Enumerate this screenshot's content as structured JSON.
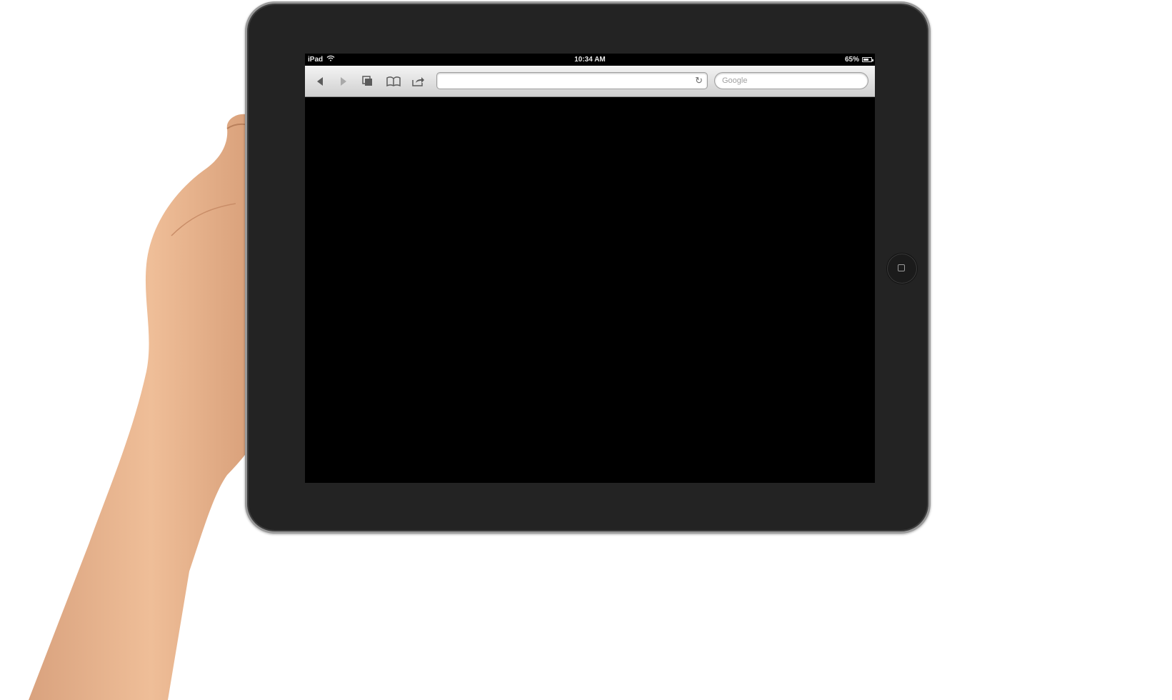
{
  "status_bar": {
    "device": "iPad",
    "time": "10:34 AM",
    "battery": "65%",
    "battery_level": 0.65
  },
  "toolbar": {
    "back_icon": "back-arrow-icon",
    "forward_icon": "forward-arrow-icon",
    "tabs_icon": "pages-icon",
    "bookmarks_icon": "bookmarks-book-icon",
    "share_icon": "share-icon",
    "url_value": "",
    "search_placeholder": "Google"
  },
  "colors": {
    "bezel": "#232323",
    "screen": "#000000",
    "toolbar_top": "#f4f4f4",
    "toolbar_bottom": "#cfcfcf"
  }
}
